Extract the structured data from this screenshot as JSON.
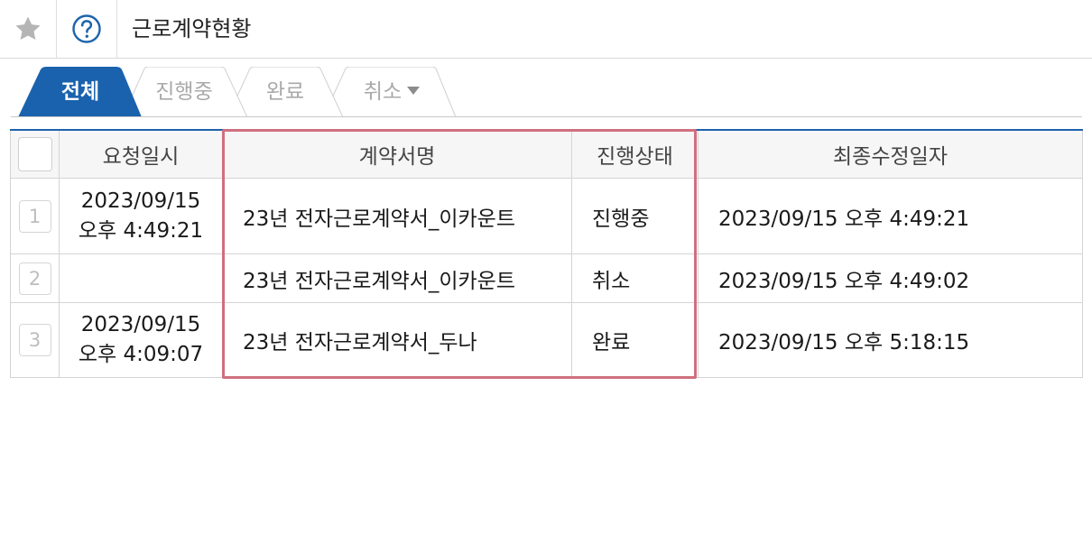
{
  "header": {
    "star_icon": "star-icon",
    "help_icon": "help-circle-icon",
    "title": "근로계약현황"
  },
  "tabs": [
    {
      "label": "전체",
      "active": true
    },
    {
      "label": "진행중",
      "active": false
    },
    {
      "label": "완료",
      "active": false
    },
    {
      "label": "취소",
      "active": false,
      "has_dropdown": true
    }
  ],
  "table": {
    "columns": [
      "",
      "요청일시",
      "계약서명",
      "진행상태",
      "최종수정일자"
    ],
    "rows": [
      {
        "num": "1",
        "request_date": "2023/09/15",
        "request_time": "오후 4:49:21",
        "name": "23년 전자근로계약서_이카운트",
        "status": "진행중",
        "modified": "2023/09/15 오후 4:49:21"
      },
      {
        "num": "2",
        "request_date": "",
        "request_time": "",
        "name": "23년 전자근로계약서_이카운트",
        "status": "취소",
        "modified": "2023/09/15 오후 4:49:02"
      },
      {
        "num": "3",
        "request_date": "2023/09/15",
        "request_time": "오후 4:09:07",
        "name": "23년 전자근로계약서_두나",
        "status": "완료",
        "modified": "2023/09/15 오후 5:18:15"
      }
    ]
  },
  "colors": {
    "accent": "#1e63ac",
    "active_tab": "#1a62ad",
    "help_icon": "#1e63ac",
    "highlight": "#cf6f7e",
    "star": "#b5b5b5"
  }
}
